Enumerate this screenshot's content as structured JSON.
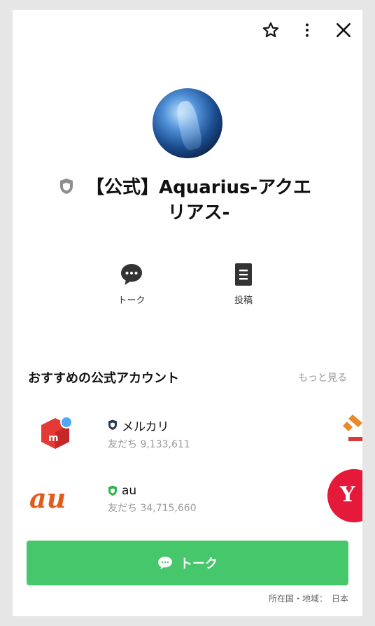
{
  "profile": {
    "name": "【公式】Aquarius-アクエリアス-"
  },
  "topbar": {
    "icons": [
      "star-icon",
      "more-vertical-icon",
      "close-icon"
    ]
  },
  "actions": [
    {
      "label": "トーク",
      "icon": "chat-bubble-icon"
    },
    {
      "label": "投稿",
      "icon": "post-document-icon"
    }
  ],
  "recommend": {
    "title": "おすすめの公式アカウント",
    "more": "もっと見る",
    "items": [
      {
        "name": "メルカリ",
        "friends": "友だち 9,133,611",
        "shield_color": "#2b3a55"
      },
      {
        "name": "au",
        "friends": "友だち 34,715,660",
        "shield_color": "#2fb34a"
      }
    ]
  },
  "talk_button": {
    "label": "トーク"
  },
  "footer": {
    "label": "所在国・地域：",
    "value": "日本"
  },
  "colors": {
    "accent_green": "#47c76b"
  }
}
